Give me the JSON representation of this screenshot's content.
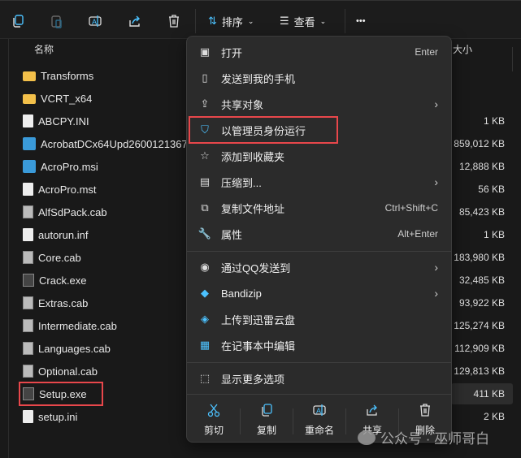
{
  "toolbar": {
    "sort_label": "排序",
    "view_label": "查看",
    "more_label": "•••"
  },
  "columns": {
    "name": "名称",
    "size": "大小"
  },
  "files": [
    {
      "name": "Transforms",
      "type": "folder",
      "size": ""
    },
    {
      "name": "VCRT_x64",
      "type": "folder",
      "size": ""
    },
    {
      "name": "ABCPY.INI",
      "type": "ini",
      "size": "1 KB"
    },
    {
      "name": "AcrobatDCx64Upd2600121367",
      "type": "msi",
      "size": "859,012 KB"
    },
    {
      "name": "AcroPro.msi",
      "type": "msi",
      "size": "12,888 KB"
    },
    {
      "name": "AcroPro.mst",
      "type": "doc",
      "size": "56 KB"
    },
    {
      "name": "AlfSdPack.cab",
      "type": "cab",
      "size": "85,423 KB"
    },
    {
      "name": "autorun.inf",
      "type": "ini",
      "size": "1 KB"
    },
    {
      "name": "Core.cab",
      "type": "cab",
      "size": "183,980 KB"
    },
    {
      "name": "Crack.exe",
      "type": "exe",
      "size": "32,485 KB"
    },
    {
      "name": "Extras.cab",
      "type": "cab",
      "size": "93,922 KB"
    },
    {
      "name": "Intermediate.cab",
      "type": "cab",
      "size": "125,274 KB"
    },
    {
      "name": "Languages.cab",
      "type": "cab",
      "size": "112,909 KB"
    },
    {
      "name": "Optional.cab",
      "type": "cab",
      "size": "129,813 KB"
    },
    {
      "name": "Setup.exe",
      "type": "exe",
      "size": "411 KB"
    },
    {
      "name": "setup.ini",
      "type": "ini",
      "size": "2 KB"
    }
  ],
  "menu": {
    "items": [
      {
        "label": "打开",
        "shortcut": "Enter"
      },
      {
        "label": "发送到我的手机",
        "shortcut": ""
      },
      {
        "label": "共享对象",
        "shortcut": ""
      },
      {
        "label": "以管理员身份运行",
        "shortcut": ""
      },
      {
        "label": "添加到收藏夹",
        "shortcut": ""
      },
      {
        "label": "压缩到...",
        "shortcut": ""
      },
      {
        "label": "复制文件地址",
        "shortcut": "Ctrl+Shift+C"
      },
      {
        "label": "属性",
        "shortcut": "Alt+Enter"
      },
      {
        "label": "通过QQ发送到",
        "shortcut": ""
      },
      {
        "label": "Bandizip",
        "shortcut": ""
      },
      {
        "label": "上传到迅雷云盘",
        "shortcut": ""
      },
      {
        "label": "在记事本中编辑",
        "shortcut": ""
      },
      {
        "label": "显示更多选项",
        "shortcut": ""
      }
    ],
    "arrow": "›",
    "bottom": [
      "剪切",
      "复制",
      "重命名",
      "共享",
      "删除"
    ]
  },
  "watermark": "公众号 · 巫师哥白",
  "colors": {
    "accent": "#4cc2ff",
    "highlight": "#e8474b"
  }
}
